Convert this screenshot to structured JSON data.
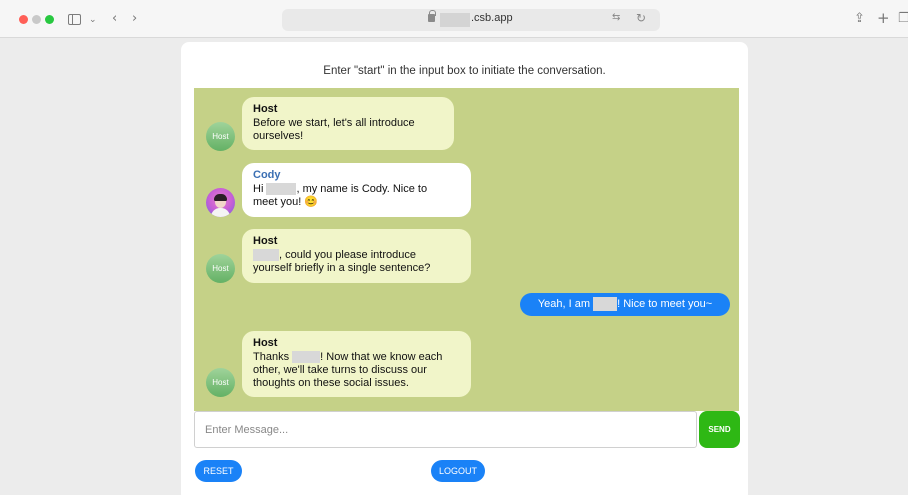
{
  "browser": {
    "url": ".csb.app",
    "icons": [
      "sidebar-icon",
      "chevron-down-icon",
      "back-icon",
      "forward-icon",
      "lock-icon",
      "translate-icon",
      "reload-icon",
      "share-icon",
      "new-tab-icon",
      "tabs-icon"
    ]
  },
  "chat": {
    "instruction": "Enter \"start\" in the input box to initiate the conversation.",
    "messages": [
      {
        "sender": "Host",
        "avatar": "Host",
        "line1": "Before we start, let's all introduce",
        "line2": "ourselves!"
      },
      {
        "sender": "Cody",
        "pre": "Hi ",
        "post": ", my name is Cody. Nice to",
        "line2": "meet you! 😊"
      },
      {
        "sender": "Host",
        "avatar": "Host",
        "post": ", could you please introduce",
        "line2": "yourself briefly in a single sentence?"
      },
      {
        "user_pre": "Yeah, I am ",
        "user_post": "! Nice to meet you~"
      },
      {
        "sender": "Host",
        "avatar": "Host",
        "pre": "Thanks ",
        "post": "! Now that we know each",
        "line2": "other, we'll take turns to discuss our",
        "line3": "thoughts on these social issues."
      }
    ]
  },
  "input": {
    "placeholder": "Enter Message...",
    "send_label": "SEND"
  },
  "buttons": {
    "reset": "RESET",
    "logout": "LOGOUT"
  },
  "colors": {
    "chat_bg": "#c5d187",
    "accent_blue": "#1a82f7",
    "send_green": "#2eb814",
    "host_bubble": "#f1f5c9"
  }
}
